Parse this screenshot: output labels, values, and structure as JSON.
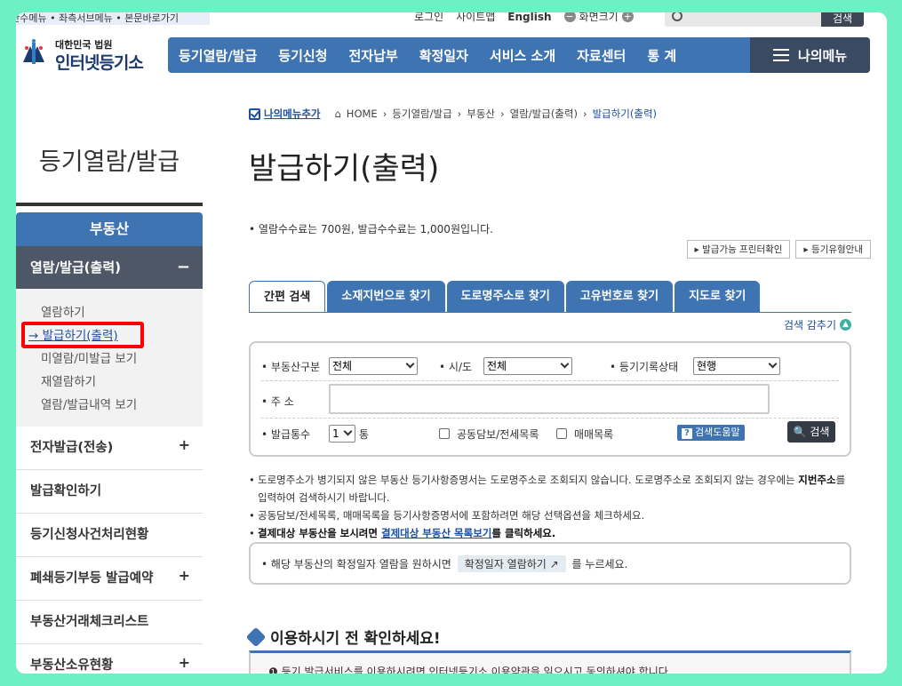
{
  "skip_links": "정단수메뉴 • 좌측서브메뉴 • 본문바로가기",
  "util": {
    "login": "로그인",
    "sitemap": "사이트맵",
    "english": "English",
    "zoom_label": "화면크기",
    "search_button": "검색"
  },
  "logo": {
    "court": "대한민국 법원",
    "name": "인터넷등기소"
  },
  "gnb": {
    "items": [
      "등기열람/발급",
      "등기신청",
      "전자납부",
      "확정일자",
      "서비스 소개",
      "자료센터",
      "통 계"
    ],
    "mymenu": "나의메뉴"
  },
  "sidebar": {
    "title": "등기열람/발급",
    "category": "부동산",
    "open_item": "열람/발급(출력)",
    "sub_items": [
      "열람하기",
      "→ 발급하기(출력)",
      "미열람/미발급 보기",
      "재열람하기",
      "열람/발급내역 보기"
    ],
    "items": [
      {
        "label": "전자발급(전송)",
        "plus": "+"
      },
      {
        "label": "발급확인하기",
        "plus": ""
      },
      {
        "label": "등기신청사건처리현황",
        "plus": ""
      },
      {
        "label": "폐쇄등기부등 발급예약",
        "plus": "+"
      },
      {
        "label": "부동산거래체크리스트",
        "plus": ""
      },
      {
        "label": "부동산소유현황",
        "plus": "+"
      }
    ]
  },
  "breadcrumb": {
    "mymenu_add": "나의메뉴추가",
    "path": [
      "HOME",
      "등기열람/발급",
      "부동산",
      "열람/발급(출력)",
      "발급하기(출력)"
    ]
  },
  "page_title": "발급하기(출력)",
  "fee_notice": "열람수수료는 700원, 발급수수료는 1,000원입니다.",
  "small_buttons": [
    "발급가능 프린터확인",
    "등기유형안내"
  ],
  "tabs": [
    "간편 검색",
    "소재지번으로 찾기",
    "도로명주소로 찾기",
    "고유번호로 찾기",
    "지도로 찾기"
  ],
  "fold_label": "검색 감추기",
  "search": {
    "type_label": "부동산구분",
    "type_value": "전체",
    "sido_label": "시/도",
    "sido_value": "전체",
    "status_label": "등기기록상태",
    "status_value": "현행",
    "address_label": "주 소",
    "address_value": "",
    "count_label": "발급통수",
    "count_value": "1",
    "count_unit": "통",
    "opt1": "공동담보/전세목록",
    "opt2": "매매목록",
    "help": "검색도움말",
    "go": "검색"
  },
  "notes": {
    "n1": "도로명주소가 병기되지 않은 부동산 등기사항증명서는 도로명주소로 조회되지 않습니다. 도로명주소로 조회되지 않는 경우에는 ",
    "n1_bold": "지번주소",
    "n1_end": "를 입력하여 검색하시기 바랍니다.",
    "n2": "공동담보/전세목록, 매매목록을 등기사항증명서에 포함하려면 해당 선택옵션을 체크하세요.",
    "n3_bold": "결제대상 부동산을 보시려면 ",
    "n3_link": "결제대상 부동산 목록보기",
    "n3_end": "를 클릭하세요."
  },
  "confirm": {
    "pre": "해당 부동산의 확정일자 열람을 원하시면",
    "button": "확정일자 열람하기",
    "post": "를 누르세요."
  },
  "before_title": "이용하시기 전 확인하세요!",
  "info_line": "등기 발급서비스를 이용하시려면 인터넷등기소 이용약관을 읽으시고 동의하셔야 합니다."
}
